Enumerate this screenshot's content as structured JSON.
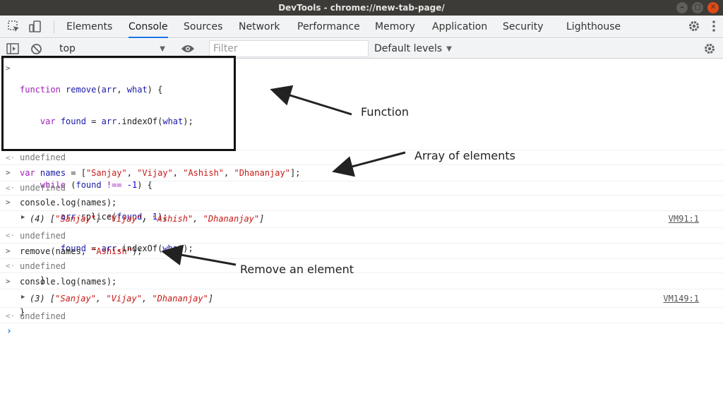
{
  "window": {
    "title": "DevTools - chrome://new-tab-page/"
  },
  "tabs": [
    "Elements",
    "Console",
    "Sources",
    "Network",
    "Performance",
    "Memory",
    "Application",
    "Security",
    "Lighthouse"
  ],
  "active_tab": "Console",
  "toolbar": {
    "context": "top",
    "filter_placeholder": "Filter",
    "levels": "Default levels"
  },
  "console": {
    "function_lines": [
      "function remove(arr, what) {",
      "    var found = arr.indexOf(what);",
      "",
      "    while (found !== -1) {",
      "        arr.splice(found, 1);",
      "        found = arr.indexOf(what);",
      "    }",
      "}"
    ],
    "undefined": "undefined",
    "names_decl": "var names = [\"Sanjay\", \"Vijay\", \"Ashish\", \"Dhananjay\"];",
    "log1": "console.log(names);",
    "out1": "(4) [\"Sanjay\", \"Vijay\", \"Ashish\", \"Dhananjay\"]",
    "out1_link": "VM91:1",
    "remove_call": "remove(names, \"Ashish\");",
    "log2": "console.log(names);",
    "out2": "(3) [\"Sanjay\", \"Vijay\", \"Dhananjay\"]",
    "out2_link": "VM149:1"
  },
  "annotations": {
    "function": "Function",
    "array": "Array of elements",
    "remove": "Remove an element"
  },
  "colors": {
    "keyword": "#9f1fb8",
    "string": "#c41a16",
    "active_tab_underline": "#1a73e8"
  }
}
